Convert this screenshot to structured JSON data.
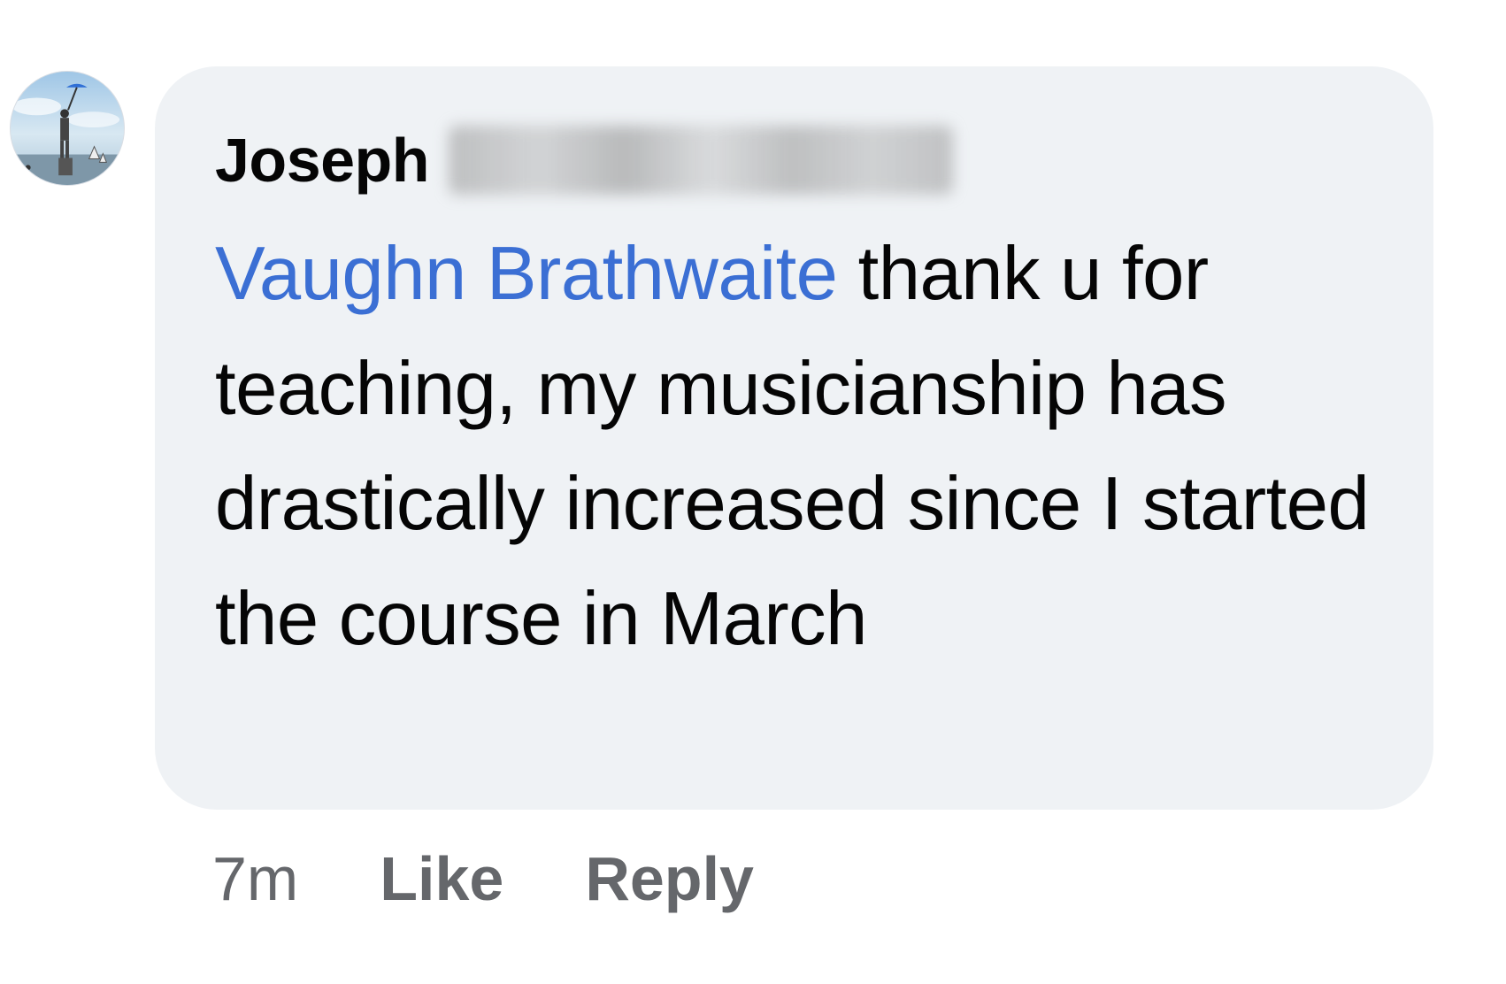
{
  "comment": {
    "author_first_name": "Joseph",
    "author_last_name_redacted": "",
    "mention": "Vaughn Brathwaite",
    "text": " thank u for teaching, my musicianship has drastically increased since I started the course in March",
    "timestamp": "7m",
    "like_label": "Like",
    "reply_label": "Reply"
  },
  "avatar": {
    "icon": "profile-photo"
  },
  "colors": {
    "bubble_background": "#eff2f5",
    "mention": "#3b6fd4",
    "text": "#050505",
    "meta": "#65676b"
  }
}
